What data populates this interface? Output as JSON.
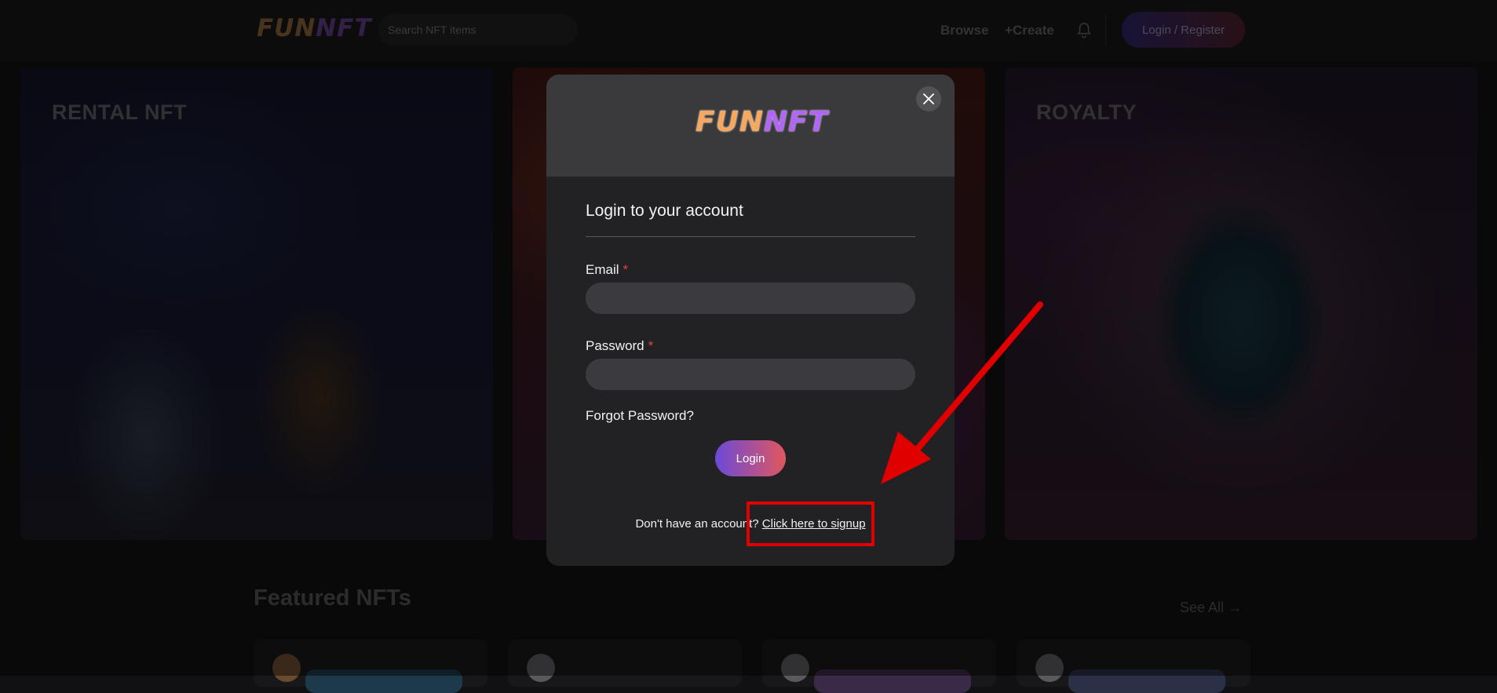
{
  "header": {
    "logo_part1": "FUN",
    "logo_part2": "NFT",
    "search_placeholder": "Search NFT items",
    "nav": {
      "browse": "Browse",
      "create": "+Create"
    },
    "login_register": "Login / Register"
  },
  "hero": {
    "cards": [
      {
        "title": "RENTAL NFT"
      },
      {
        "title": ""
      },
      {
        "title": "ROYALTY"
      }
    ]
  },
  "featured": {
    "title": "Featured NFTs",
    "see_all": "See All"
  },
  "modal": {
    "logo_part1": "FUN",
    "logo_part2": "NFT",
    "title": "Login to your account",
    "email_label": "Email",
    "password_label": "Password",
    "required_mark": "*",
    "forgot_password": "Forgot Password?",
    "login_button": "Login",
    "signup_prompt": "Don't have an account?",
    "signup_link": "Click here to signup"
  },
  "colors": {
    "annotation": "#e00000",
    "login_gradient_start": "#6b4ad8",
    "login_gradient_end": "#e0575f",
    "required": "#e0453a"
  },
  "icons": [
    "bell-icon",
    "close-icon",
    "arrow-right-icon",
    "avatar-icon"
  ]
}
